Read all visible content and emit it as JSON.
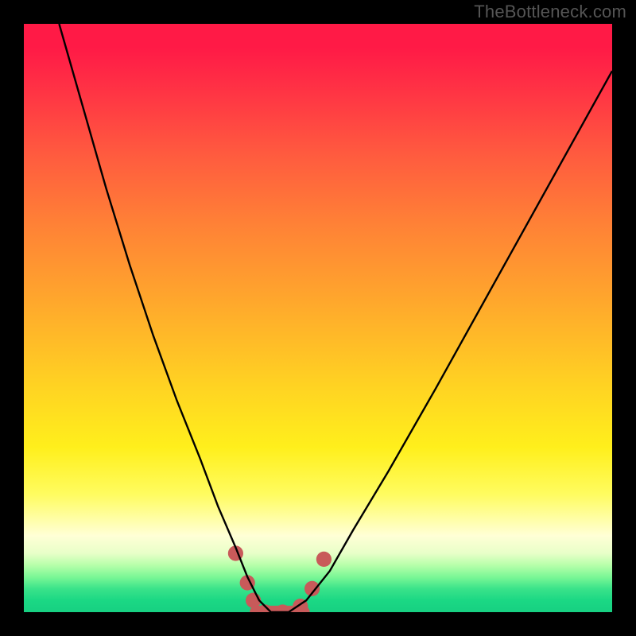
{
  "watermark": "TheBottleneck.com",
  "chart_data": {
    "type": "line",
    "title": "",
    "xlabel": "",
    "ylabel": "",
    "xlim": [
      0,
      100
    ],
    "ylim": [
      0,
      100
    ],
    "grid": false,
    "legend": false,
    "gradient_bands": [
      {
        "name": "red",
        "color": "#ff1a46",
        "y_pct": 0
      },
      {
        "name": "orange",
        "color": "#ff8136",
        "y_pct": 40
      },
      {
        "name": "yellow",
        "color": "#ffef1c",
        "y_pct": 72
      },
      {
        "name": "pale",
        "color": "#ffffd6",
        "y_pct": 87
      },
      {
        "name": "green",
        "color": "#17d082",
        "y_pct": 100
      }
    ],
    "series": [
      {
        "name": "bottleneck-curve",
        "color": "#000000",
        "x": [
          6,
          10,
          14,
          18,
          22,
          26,
          30,
          33,
          36,
          38,
          40,
          42,
          45,
          48,
          52,
          56,
          62,
          70,
          80,
          90,
          100
        ],
        "values": [
          100,
          86,
          72,
          59,
          47,
          36,
          26,
          18,
          11,
          6,
          2,
          0,
          0,
          2,
          7,
          14,
          24,
          38,
          56,
          74,
          92
        ]
      }
    ],
    "markers": {
      "name": "valley-markers",
      "color": "#c85a5a",
      "radius_pct": 1.3,
      "points": [
        {
          "x": 36,
          "y": 10
        },
        {
          "x": 38,
          "y": 5
        },
        {
          "x": 39,
          "y": 2
        },
        {
          "x": 41,
          "y": 0
        },
        {
          "x": 44,
          "y": 0
        },
        {
          "x": 47,
          "y": 1
        },
        {
          "x": 49,
          "y": 4
        },
        {
          "x": 51,
          "y": 9
        }
      ],
      "bar": {
        "x0": 39.5,
        "x1": 47.5,
        "y": 0,
        "thickness_pct": 2.2
      }
    }
  }
}
